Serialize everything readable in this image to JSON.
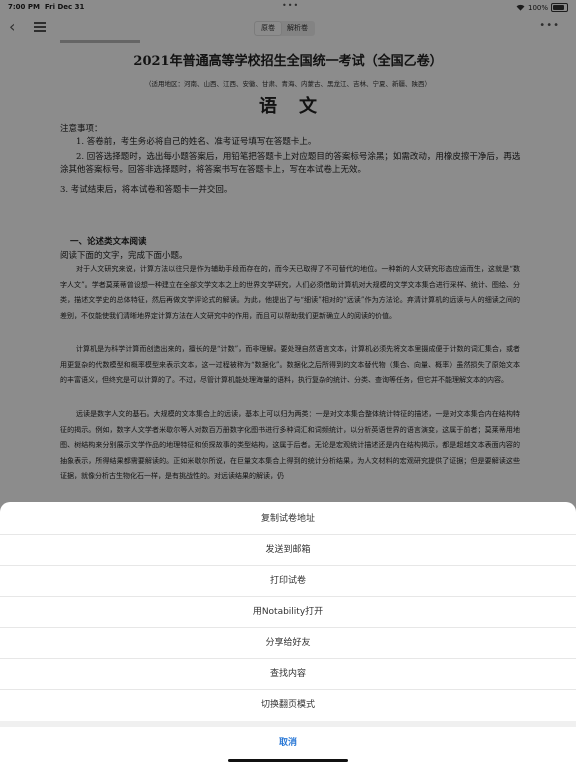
{
  "status_bar": {
    "time": "7:00 PM",
    "date": "Fri Dec 31",
    "battery": "100%"
  },
  "navbar": {
    "back_icon": "chevron-left",
    "list_icon": "list",
    "segments": [
      {
        "label": "原卷",
        "active": true
      },
      {
        "label": "解析卷",
        "active": false
      }
    ],
    "more_icon": "ellipsis"
  },
  "document": {
    "title": "2021年普通高等学校招生全国统一考试（全国乙卷）",
    "regions": "（适用地区：河南、山西、江西、安徽、甘肃、青海、内蒙古、黑龙江、吉林、宁夏、新疆、陕西）",
    "subject": "语文",
    "notice_title": "注意事项：",
    "notices": [
      "1. 答卷前，考生务必将自己的姓名、准考证号填写在答题卡上。",
      "2. 回答选择题时，选出每小题答案后，用铅笔把答题卡上对应题目的答案标号涂黑；如需改动，用橡皮擦干净后，再选涂其他答案标号。回答非选择题时，将答案书写在答题卡上，写在本试卷上无效。",
      "3. 考试结束后，将本试卷和答题卡一并交回。"
    ],
    "section_title": "一、论述类文本阅读",
    "read_instruction": "阅读下面的文字，完成下面小题。",
    "paragraphs": [
      "对于人文研究来说，计算方法以往只是作为辅助手段而存在的，而今天已取得了不可替代的地位。一种新的人文研究形态应运而生，这就是“数字人文”。学者莫莱蒂曾设想一种建立在全部文学文本之上的世界文学研究，人们必须借助计算机对大规模的文学文本集合进行采样、统计、图绘、分类，描述文学史的总体特征，然后再做文学评论式的解读。为此，他提出了与“细读”相对的“远读”作为方法论。弃清计算机的远读与人的细读之间的差别，不仅能使我们清晰地界定计算方法在人文研究中的作用，而且可以帮助我们更新确立人的阅读的价值。",
      "计算机是为科学计算而创造出来的，擅长的是“计数”，而非理解。要处理自然语言文本，计算机必须先将文本里摄成便于计数的词汇集合，或者用更复杂的代数模型和概率模型来表示文本，这一过程被称为“数据化”。数据化之后所得到的文本替代物（集合、向量、概率）虽然损失了原始文本的丰富语义，但终究是可以计算的了。不过，尽管计算机能处理海量的语料，执行复杂的统计、分类、查询等任务，但它并不能理解文本的内容。",
      "远读是数字人文的基石。大规模的文本集合上的远读，基本上可以归为两类：一是对文本集合整体统计特征的描述，一是对文本集合内在结构特征的揭示。例如，数字人文学者米歇尔等人对数百万册数字化图书进行多种词汇和词频统计，以分析英语世界的语言演变，这属于前者；莫莱蒂用地图、树结构来分别展示文学作品的地理特征和侦探故事的类型结构，这属于后者。无论是宏观统计描述还是内在结构揭示，都是超越文本表面内容的抽象表示，所得结果都需要解读的。正如米歇尔所说，在巨量文本集合上得到的统计分析结果，为人文材料的宏观研究提供了证据；但是要解读这些证据，就像分析古生物化石一样，是有挑战性的。对远读结果的解读，仍"
    ]
  },
  "action_sheet": {
    "items": [
      "复制试卷地址",
      "发送到邮箱",
      "打印试卷",
      "用Notability打开",
      "分享给好友",
      "查找内容",
      "切换翻页模式"
    ],
    "cancel": "取消"
  }
}
